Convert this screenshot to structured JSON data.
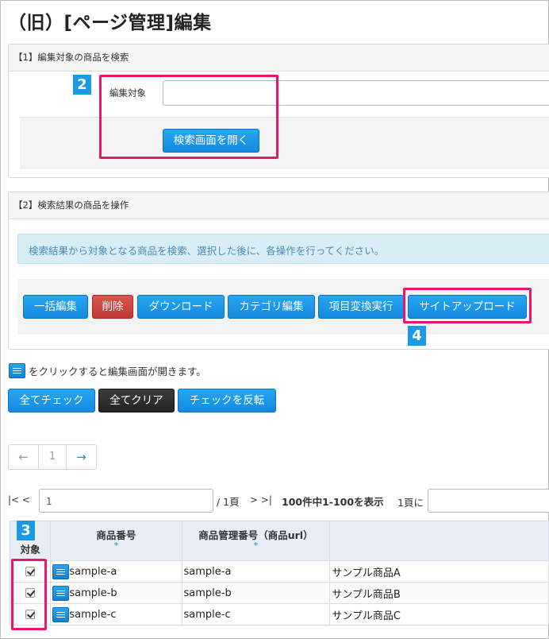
{
  "page": {
    "title": "（旧）[ページ管理]編集"
  },
  "section1": {
    "heading": "【1】編集対象の商品を検索",
    "target_label": "編集対象",
    "target_value": "",
    "open_search_button": "検索画面を開く"
  },
  "section2": {
    "heading": "【2】検索結果の商品を操作",
    "info_text": "検索結果から対象となる商品を検索、選択した後に、各操作を行ってください。",
    "buttons": {
      "bulk_edit": "一括編集",
      "delete": "削除",
      "download": "ダウンロード",
      "category_edit": "カテゴリ編集",
      "item_convert": "項目変換実行",
      "site_upload": "サイトアップロード"
    }
  },
  "hint": {
    "text": "をクリックすると編集画面が開きます。"
  },
  "check_buttons": {
    "check_all": "全てチェック",
    "clear_all": "全てクリア",
    "invert": "チェックを反転"
  },
  "pager": {
    "prev": "←",
    "current": "1",
    "next": "→"
  },
  "pagination": {
    "first": "|< <",
    "page_input": "1",
    "total_pages": "/ 1頁",
    "last": "> >|",
    "summary": "100件中1-100を表示",
    "per_page_label": "1頁に"
  },
  "callouts": {
    "n2": "2",
    "n3": "3",
    "n4": "4"
  },
  "table": {
    "headers": {
      "target": "対象",
      "product_no": "商品番号",
      "manage_no": "商品管理番号（商品url）",
      "sort_mark": "*"
    },
    "rows": [
      {
        "checked": true,
        "product_no": "sample-a",
        "manage_no": "sample-a",
        "name": "サンプル商品A"
      },
      {
        "checked": true,
        "product_no": "sample-b",
        "manage_no": "sample-b",
        "name": "サンプル商品B"
      },
      {
        "checked": true,
        "product_no": "sample-c",
        "manage_no": "sample-c",
        "name": "サンプル商品C"
      }
    ]
  },
  "colors": {
    "primary": "#1a8fe3",
    "danger": "#d0433f",
    "dark": "#2b2b2b",
    "callout": "#e8166f",
    "info_bg": "#d9edf7"
  }
}
